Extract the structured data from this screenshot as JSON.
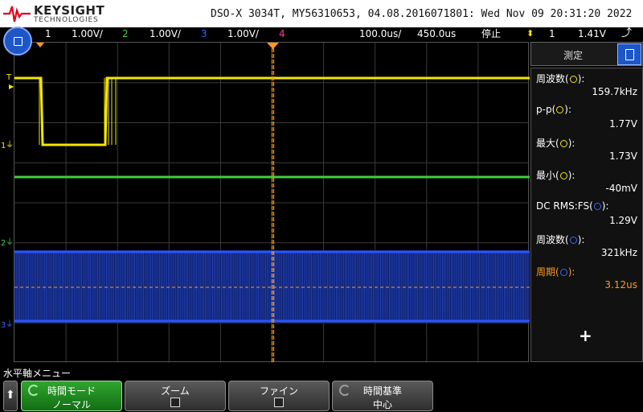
{
  "header": {
    "brand": "KEYSIGHT",
    "brand_sub": "TECHNOLOGIES",
    "title": "DSO-X 3034T, MY56310653, 04.08.2016071801: Wed Nov 09 20:31:20 2022"
  },
  "status": {
    "ch1": {
      "num": "1",
      "scale": "1.00V/",
      "color": "#f5e600"
    },
    "ch2": {
      "num": "2",
      "scale": "1.00V/",
      "color": "#3ecf3e"
    },
    "ch3": {
      "num": "3",
      "scale": "1.00V/",
      "color": "#3a66ff"
    },
    "ch4": {
      "num": "4",
      "color": "#ff3b8f"
    },
    "timebase": "100.0us/",
    "delay": "450.0us",
    "run_state": "停止",
    "trigger_icon": "trigger-level-icon",
    "trigger_source": "1",
    "trigger_level": "1.41V"
  },
  "screen": {
    "markers": {
      "trigger": "T",
      "ch1": "1",
      "ch2": "2",
      "ch3": "3"
    },
    "colors": {
      "grid": "#3a3a3a",
      "ch1": "#f5e600",
      "ch2": "#3ecf3e",
      "ch3": "#2a55ff",
      "cursor": "#ff9a1a"
    }
  },
  "panel": {
    "title": "測定",
    "measurements": [
      {
        "label": "周波数",
        "source": "1",
        "source_color": "#f5e600",
        "value": "159.7kHz",
        "active": false
      },
      {
        "label": "p-p",
        "source": "1",
        "source_color": "#f5e600",
        "value": "1.77V",
        "active": false
      },
      {
        "label": "最大",
        "source": "1",
        "source_color": "#f5e600",
        "value": "1.73V",
        "active": false
      },
      {
        "label": "最小",
        "source": "1",
        "source_color": "#f5e600",
        "value": "-40mV",
        "active": false
      },
      {
        "label": "DC RMS:FS",
        "source": "3",
        "source_color": "#3a66ff",
        "value": "1.29V",
        "active": false
      },
      {
        "label": "周波数",
        "source": "3",
        "source_color": "#3a66ff",
        "value": "321kHz",
        "active": false
      },
      {
        "label": "周期",
        "source": "3",
        "source_color": "#3a66ff",
        "value": "3.12us",
        "active": true
      }
    ],
    "add_label": "+"
  },
  "softkeys": {
    "menu_label": "水平軸メニュー",
    "back_icon": "up-arrow-icon",
    "time_mode": {
      "l1": "時間モード",
      "l2": "ノーマル"
    },
    "zoom": {
      "l1": "ズーム"
    },
    "fine": {
      "l1": "ファイン"
    },
    "time_ref": {
      "l1": "時間基準",
      "l2": "中心"
    }
  }
}
